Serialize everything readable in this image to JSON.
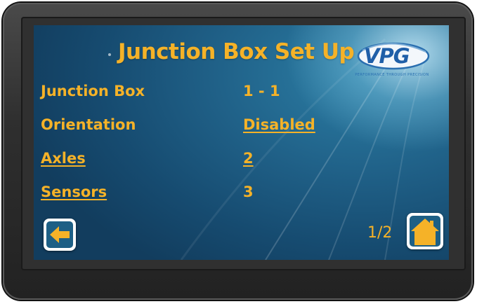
{
  "screen": {
    "title": "Junction Box Set Up",
    "logo": {
      "text": "VPG",
      "tagline": "PERFORMANCE THROUGH PRECISION"
    },
    "rows": [
      {
        "label": "Junction Box",
        "value": "1 - 1"
      },
      {
        "label": "Orientation",
        "value": "Disabled"
      },
      {
        "label": "Axles",
        "value": "2"
      },
      {
        "label": "Sensors",
        "value": "3"
      }
    ],
    "back_icon": "back-arrow-icon",
    "home_icon": "home-icon",
    "page_indicator": "1/2"
  },
  "colors": {
    "accent": "#f5b228",
    "screen_bg": "#1a5a82",
    "button_bg": "#1d5f85",
    "bezel": "#303030"
  }
}
